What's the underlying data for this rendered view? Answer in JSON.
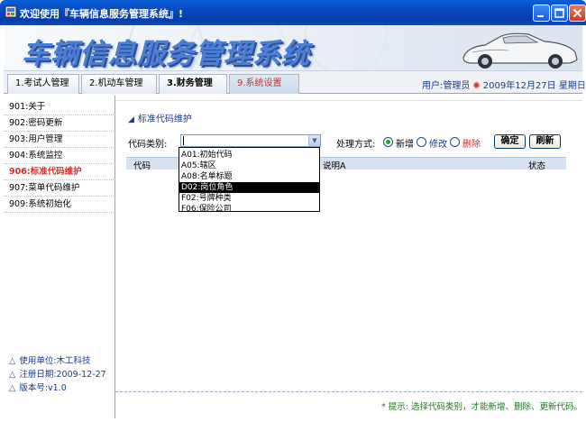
{
  "window": {
    "title": "欢迎使用『车辆信息服务管理系统』!",
    "controls": [
      "minimize",
      "maximize",
      "close"
    ]
  },
  "banner": {
    "title": "车辆信息服务管理系统"
  },
  "tabs": [
    {
      "label": "1.考试人管理"
    },
    {
      "label": "2.机动车管理"
    },
    {
      "label": "3.财务管理"
    },
    {
      "label": "9.系统设置",
      "active": true
    }
  ],
  "userinfo": {
    "user": "用户:管理员",
    "date": "2009年12月27日 星期日"
  },
  "sidebar": {
    "items": [
      {
        "label": "901:关于"
      },
      {
        "label": "902:密码更新"
      },
      {
        "label": "903:用户管理"
      },
      {
        "label": "904:系统监控"
      },
      {
        "label": "906:标准代码维护",
        "active": true
      },
      {
        "label": "907:菜单代码维护"
      },
      {
        "label": "909:系统初始化"
      }
    ],
    "info": {
      "unit": "使用单位:木工科技",
      "regdate": "注册日期:2009-12-27",
      "version": "版本号:v1.0"
    }
  },
  "main": {
    "section_title": "标准代码维护",
    "code_type_label": "代码类别:",
    "code_type_value": "",
    "mode_label": "处理方式:",
    "modes": [
      {
        "label": "新增",
        "checked": true
      },
      {
        "label": "修改",
        "checked": false
      },
      {
        "label": "删除",
        "checked": false
      }
    ],
    "buttons": {
      "confirm": "确定",
      "refresh": "刷新"
    },
    "grid_headers": [
      "代码",
      "说明A",
      "状态"
    ],
    "dropdown_options": [
      {
        "label": "A01:初始代码"
      },
      {
        "label": "A05:辖区"
      },
      {
        "label": "A08:名单标题"
      },
      {
        "label": "D02:岗位角色",
        "selected": true
      },
      {
        "label": "F02:号牌种类"
      },
      {
        "label": "F06:保险公司"
      }
    ],
    "tip": "* 提示: 选择代码类别，才能新增、删除、更新代码。"
  },
  "colors": {
    "titlebar": "#0848c0",
    "accent_red": "#d0302a",
    "radio_checked": "#21a121",
    "tip_green": "#1f7a1f"
  }
}
